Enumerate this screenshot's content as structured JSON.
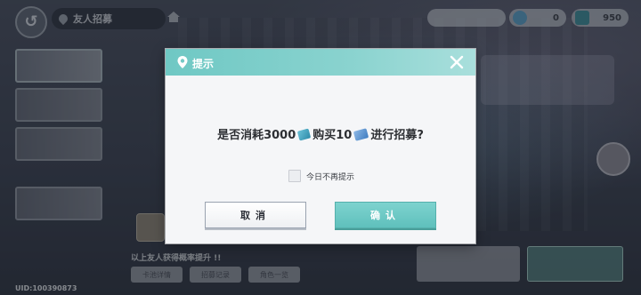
{
  "top_bar": {
    "title": "友人招募",
    "resources": [
      {
        "icon": "gem-icon",
        "value": "0"
      },
      {
        "icon": "ticket-icon",
        "value": "950"
      }
    ]
  },
  "footer": {
    "uid": "UID:100390873",
    "scroll_text": "以上友人获得概率提升 !!",
    "buttons": [
      "卡池详情",
      "招募记录",
      "角色一览"
    ]
  },
  "dialog": {
    "title": "提示",
    "message_part1": "是否消耗3000",
    "message_part2": "购买10",
    "message_part3": "进行招募?",
    "checkbox_label": "今日不再提示",
    "checkbox_checked": false,
    "cancel_label": "取消",
    "confirm_label": "确认"
  },
  "colors": {
    "header_teal": "#6fc8c4",
    "confirm_teal": "#5fc0bc",
    "dialog_bg": "#f5f6f8"
  }
}
